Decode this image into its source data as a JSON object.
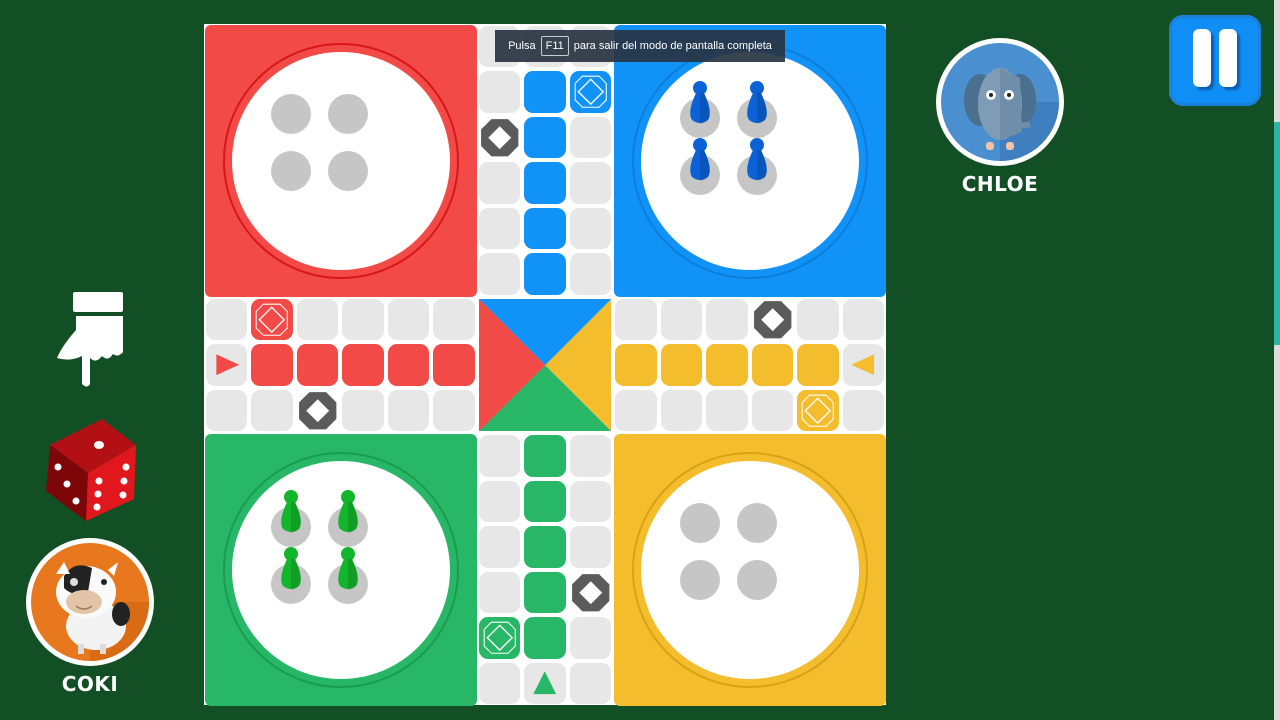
{
  "window": {
    "fullscreen_notice": {
      "prefix": "Pulsa",
      "key": "F11",
      "suffix": "para salir del modo de pantalla completa"
    }
  },
  "colors": {
    "background": "#134f25",
    "red": "#f24a46",
    "red_ring": "#d9161a",
    "blue": "#1192f7",
    "blue_ring": "#0d7ed8",
    "yellow": "#f3bd2e",
    "yellow_ring": "#d9a114",
    "green": "#27b767",
    "green_ring": "#1a9c52",
    "cell": "#e8e7e7",
    "safe_grey": "#5b5b5b",
    "slot": "#c6c6c6",
    "blue_pawn": "#0a62d6",
    "green_pawn": "#13b52a"
  },
  "players": [
    {
      "name": "CHLOE",
      "avatar": "elephant-avatar",
      "color": "blue",
      "position": "top-right"
    },
    {
      "name": "COKI",
      "avatar": "cow-avatar",
      "color": "green",
      "position": "bottom-left",
      "active_turn": true
    }
  ],
  "controls": {
    "pause_icon": "pause-icon",
    "turn_indicator_icon": "pointing-hand-icon",
    "dice": {
      "icon": "dice-icon",
      "top_face": 1,
      "left_face": 3,
      "right_face": 6
    }
  },
  "board": {
    "bases": [
      {
        "color": "red",
        "corner": "top-left",
        "pawns_in_base": 0
      },
      {
        "color": "blue",
        "corner": "top-right",
        "pawns_in_base": 4
      },
      {
        "color": "green",
        "corner": "bottom-left",
        "pawns_in_base": 4
      },
      {
        "color": "yellow",
        "corner": "bottom-right",
        "pawns_in_base": 0
      }
    ],
    "home_columns": [
      {
        "color": "red",
        "cells": [
          [
            7,
            1
          ],
          [
            7,
            2
          ],
          [
            7,
            3
          ],
          [
            7,
            4
          ],
          [
            7,
            5
          ]
        ],
        "entry_arrow": {
          "cell": [
            7,
            0
          ],
          "dir": "right"
        }
      },
      {
        "color": "blue",
        "cells": [
          [
            1,
            7
          ],
          [
            2,
            7
          ],
          [
            3,
            7
          ],
          [
            4,
            7
          ],
          [
            5,
            7
          ]
        ]
      },
      {
        "color": "yellow",
        "cells": [
          [
            7,
            9
          ],
          [
            7,
            10
          ],
          [
            7,
            11
          ],
          [
            7,
            12
          ],
          [
            7,
            13
          ]
        ],
        "entry_arrow": {
          "cell": [
            7,
            14
          ],
          "dir": "left"
        }
      },
      {
        "color": "green",
        "cells": [
          [
            9,
            7
          ],
          [
            10,
            7
          ],
          [
            11,
            7
          ],
          [
            12,
            7
          ],
          [
            13,
            7
          ]
        ],
        "entry_arrow": {
          "cell": [
            14,
            7
          ],
          "dir": "up"
        }
      }
    ],
    "start_squares": [
      {
        "color": "red",
        "cell": [
          6,
          1
        ]
      },
      {
        "color": "blue",
        "cell": [
          1,
          8
        ]
      },
      {
        "color": "yellow",
        "cell": [
          8,
          13
        ]
      },
      {
        "color": "green",
        "cell": [
          13,
          6
        ]
      }
    ],
    "safe_squares": [
      {
        "cell": [
          8,
          2
        ]
      },
      {
        "cell": [
          2,
          6
        ]
      },
      {
        "cell": [
          6,
          12
        ]
      },
      {
        "cell": [
          12,
          8
        ]
      }
    ],
    "center": {
      "triangles": [
        "blue",
        "yellow",
        "green",
        "red"
      ]
    }
  }
}
